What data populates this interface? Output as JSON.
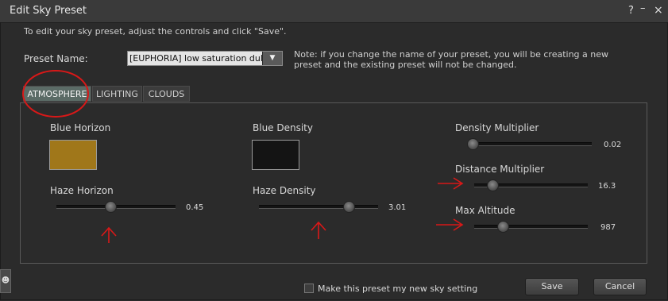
{
  "window": {
    "title": "Edit Sky Preset",
    "help_label": "?",
    "minimize_label": "–",
    "close_label": "×"
  },
  "instructions": "To edit your sky preset, adjust the controls and click \"Save\".",
  "preset": {
    "label": "Preset Name:",
    "value": "[EUPHORIA] low saturation dull",
    "dropdown_icon": "chevron-down-icon"
  },
  "note": "Note: if you change the name of your preset, you will be creating a new preset and the existing preset will not be changed.",
  "tabs": [
    {
      "label": "ATMOSPHERE",
      "active": true
    },
    {
      "label": "LIGHTING",
      "active": false
    },
    {
      "label": "CLOUDS",
      "active": false
    }
  ],
  "atmosphere": {
    "blue_horizon": {
      "label": "Blue Horizon",
      "color": "#a0771a"
    },
    "blue_density": {
      "label": "Blue Density",
      "color": "#141414"
    },
    "haze_horizon": {
      "label": "Haze Horizon",
      "value": "0.45",
      "fraction": 0.45
    },
    "haze_density": {
      "label": "Haze Density",
      "value": "3.01",
      "fraction": 0.75
    },
    "density_multiplier": {
      "label": "Density Multiplier",
      "value": "0.02",
      "fraction": 0.02
    },
    "distance_multiplier": {
      "label": "Distance Multiplier",
      "value": "16.3",
      "fraction": 0.16
    },
    "max_altitude": {
      "label": "Max Altitude",
      "value": "987",
      "fraction": 0.25
    }
  },
  "footer": {
    "checkbox_label": "Make this preset my new sky setting",
    "checked": false,
    "save_label": "Save",
    "cancel_label": "Cancel"
  },
  "side_tab_icon": "person-icon",
  "annotation_color": "#d81818"
}
